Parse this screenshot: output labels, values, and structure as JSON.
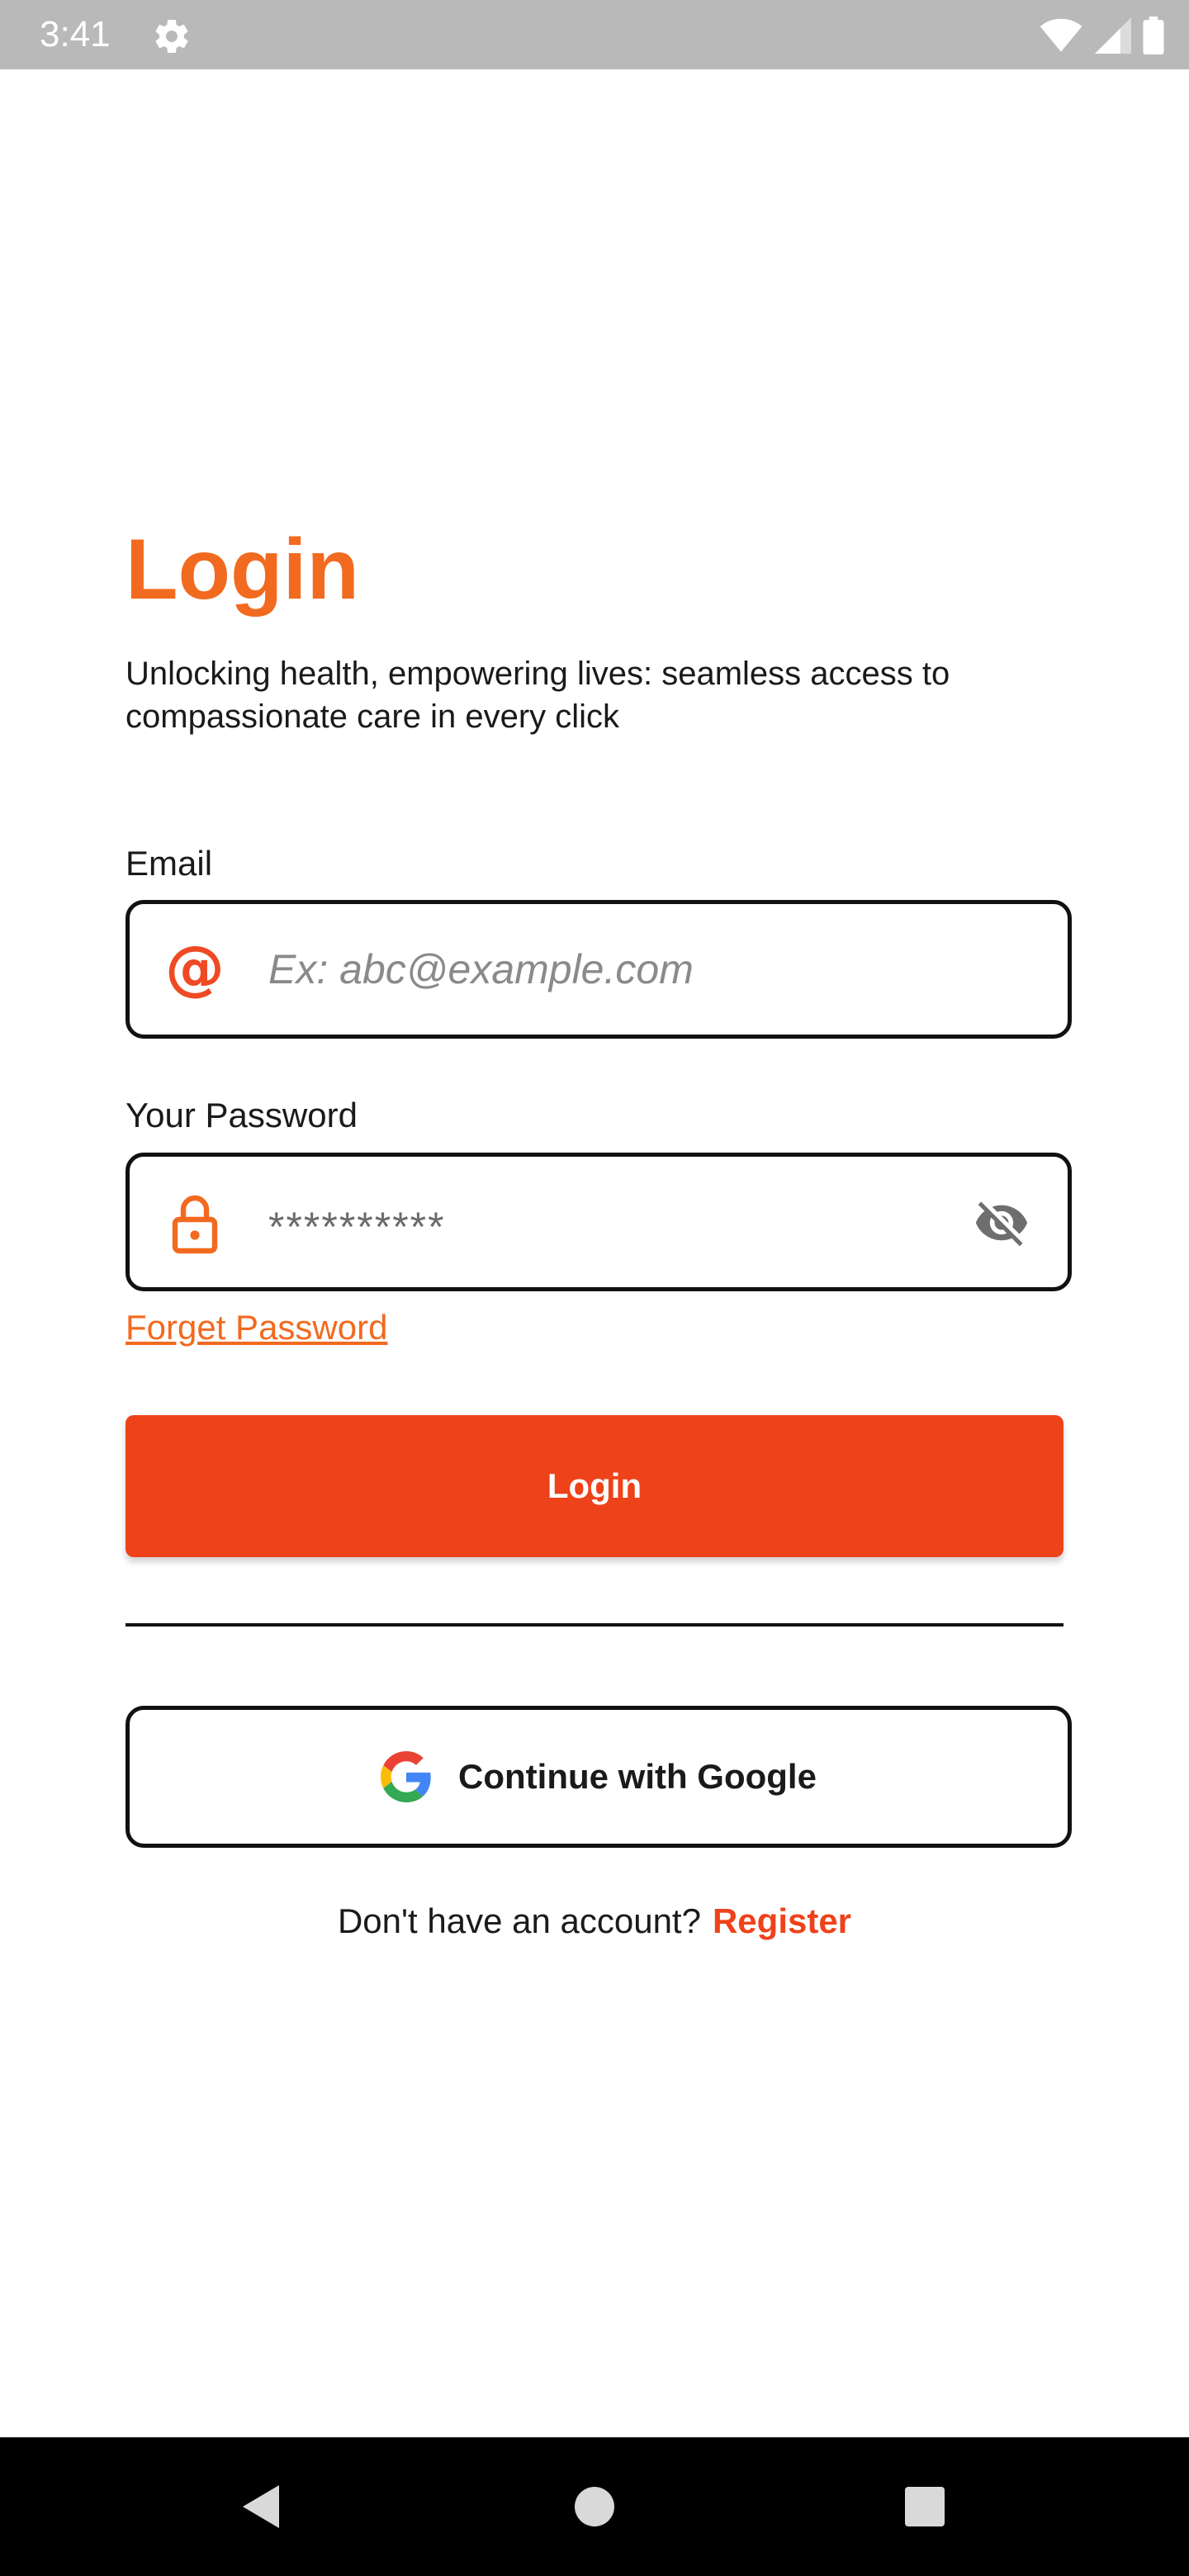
{
  "status_bar": {
    "time": "3:41",
    "icons": [
      "settings-gear-icon",
      "wifi-icon",
      "cellular-signal-icon",
      "battery-icon"
    ]
  },
  "colors": {
    "accent_orange": "#f26a1f",
    "button_red": "#ee421a",
    "status_bar_bg": "#b9b9b9",
    "nav_bar_bg": "#000000"
  },
  "login": {
    "title": "Login",
    "subtitle": "Unlocking health, empowering lives: seamless access to compassionate care in every click"
  },
  "email": {
    "label": "Email",
    "icon": "at-sign-icon",
    "placeholder": "Ex: abc@example.com",
    "value": ""
  },
  "password": {
    "label": "Your Password",
    "icon": "lock-icon",
    "value": "**********",
    "toggle_icon": "eye-off-icon"
  },
  "forget_password": "Forget Password",
  "login_button": "Login",
  "google_button": {
    "label": "Continue with Google",
    "icon": "google-logo-icon"
  },
  "register": {
    "prompt": "Don't have an account?",
    "link": "Register"
  },
  "nav_bar": {
    "buttons": [
      "back-icon",
      "home-icon",
      "recent-apps-icon"
    ]
  }
}
